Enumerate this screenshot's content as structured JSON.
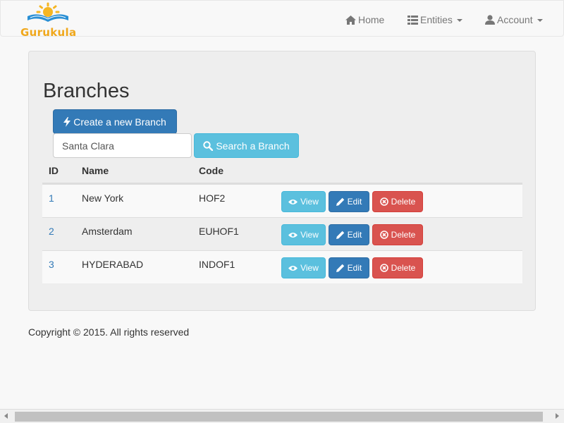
{
  "brand": {
    "name": "Gurukula"
  },
  "nav": {
    "home": "Home",
    "entities": "Entities",
    "account": "Account"
  },
  "page": {
    "title": "Branches"
  },
  "actions": {
    "create_label": "Create a new Branch",
    "search_value": "Santa Clara",
    "search_label": "Search a Branch"
  },
  "table": {
    "headers": {
      "id": "ID",
      "name": "Name",
      "code": "Code"
    },
    "rows": [
      {
        "id": "1",
        "name": "New York",
        "code": "HOF2"
      },
      {
        "id": "2",
        "name": "Amsterdam",
        "code": "EUHOF1"
      },
      {
        "id": "3",
        "name": "HYDERABAD",
        "code": "INDOF1"
      }
    ],
    "row_actions": {
      "view": "View",
      "edit": "Edit",
      "delete": "Delete"
    }
  },
  "footer": {
    "text": "Copyright © 2015. All rights reserved"
  },
  "colors": {
    "primary": "#337ab7",
    "info": "#5bc0de",
    "danger": "#d9534f",
    "brand": "#f0a81c"
  },
  "icons": {
    "home": "home-icon",
    "entities": "list-icon",
    "account": "user-icon",
    "create": "bolt-icon",
    "search": "search-icon",
    "view": "eye-icon",
    "edit": "pencil-icon",
    "delete": "remove-circle-icon"
  }
}
